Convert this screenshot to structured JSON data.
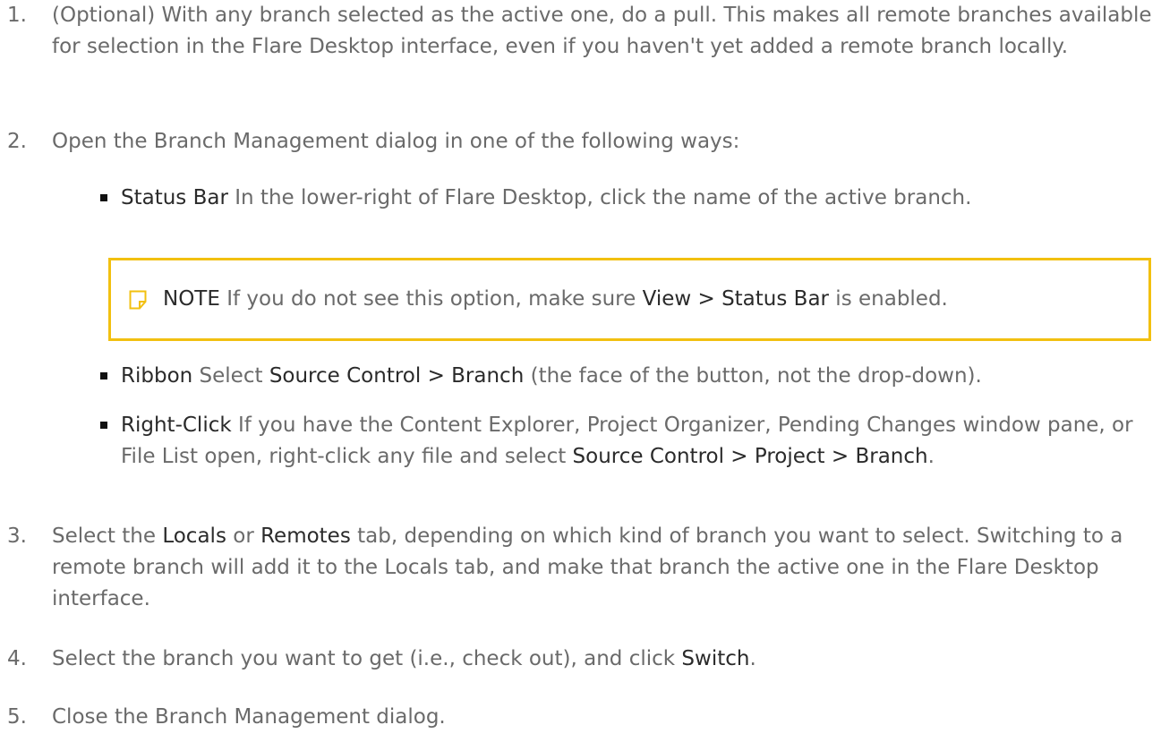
{
  "steps": [
    {
      "num": "1.",
      "parts": [
        "(Optional) With any branch selected as the active one, do a pull. This makes all remote branches available for selection in the Flare Desktop interface, even if you haven't yet added a remote branch locally."
      ]
    },
    {
      "num": "2.",
      "parts": [
        "Open the Branch Management dialog in one of the following ways:"
      ]
    },
    {
      "num": "3.",
      "parts": [
        "Select the ",
        "Locals",
        " or ",
        "Remotes",
        " tab, depending on which kind of branch you want to select. Switching to a remote branch will add it to the Locals tab, and make that branch the active one in the Flare Desktop interface."
      ]
    },
    {
      "num": "4.",
      "parts": [
        "Select the branch you want to get (i.e., check out), and click ",
        "Switch",
        "."
      ]
    },
    {
      "num": "5.",
      "parts": [
        "Close the Branch Management dialog."
      ]
    }
  ],
  "bullets": [
    {
      "parts": [
        "Status Bar",
        " In the lower-right of Flare Desktop, click the name of the active branch."
      ]
    },
    {
      "parts": [
        "Ribbon",
        " Select ",
        "Source Control > Branch",
        " (the face of the button, not the drop-down)."
      ]
    },
    {
      "parts": [
        "Right-Click",
        " If you have the Content Explorer, Project Organizer, Pending Changes window pane, or File List open, right-click any file and select ",
        "Source Control > Project > Branch",
        "."
      ]
    }
  ],
  "note": {
    "icon": "note-icon",
    "label": "NOTE",
    "parts": [
      " If you do not see this option, make sure ",
      "View > Status Bar",
      " is enabled."
    ],
    "border_color": "#f2c010",
    "icon_color": "#f2c010"
  },
  "colors": {
    "body_text": "#6a6a6a",
    "keyword_text": "#2a2a2a",
    "bullet": "#111111"
  }
}
